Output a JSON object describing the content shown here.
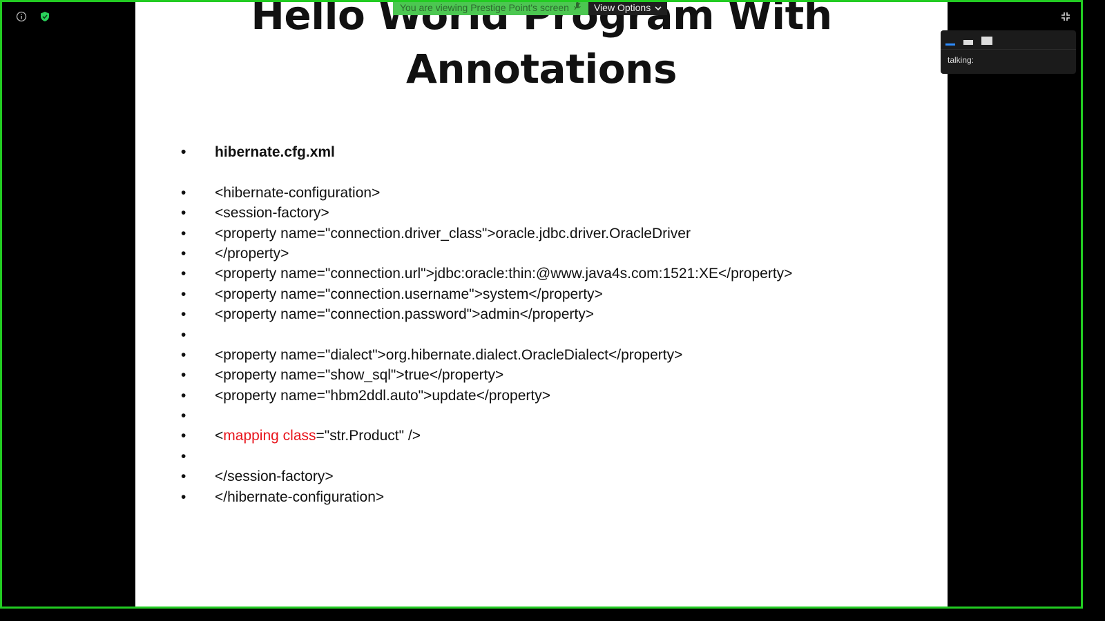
{
  "banner": {
    "viewing_text": "You are viewing Prestige Point's screen",
    "view_options_label": "View Options"
  },
  "slide": {
    "title_line1": "Hello World Program With",
    "title_line2": "Annotations",
    "bullet_char": "•",
    "lines": [
      "hibernate.cfg.xml",
      "",
      "<hibernate-configuration>",
      "<session-factory>",
      "<property name=\"connection.driver_class\">oracle.jdbc.driver.OracleDriver",
      "</property>",
      "<property name=\"connection.url\">jdbc:oracle:thin:@www.java4s.com:1521:XE</property>",
      "<property name=\"connection.username\">system</property>",
      "<property name=\"connection.password\">admin</property>",
      "",
      "<property name=\"dialect\">org.hibernate.dialect.OracleDialect</property>",
      "<property name=\"show_sql\">true</property>",
      "<property name=\"hbm2ddl.auto\">update</property>",
      "",
      "",
      "",
      "</session-factory>",
      "</hibernate-configuration>"
    ],
    "mapping_line": {
      "open": "<",
      "highlight": "mapping class",
      "rest": "=\"str.Product\" />"
    }
  },
  "panel": {
    "talking_label": "talking:"
  },
  "colors": {
    "frame": "#22cc22",
    "banner_green": "#4cc751",
    "highlight_red": "#e8141c",
    "shield": "#29d15a"
  },
  "icons": [
    "info-icon",
    "shield-icon",
    "microphone-muted-icon",
    "chevron-down-icon",
    "exit-fullscreen-icon",
    "speaker-view-icon",
    "gallery-view-icon",
    "fullscreen-view-icon"
  ]
}
